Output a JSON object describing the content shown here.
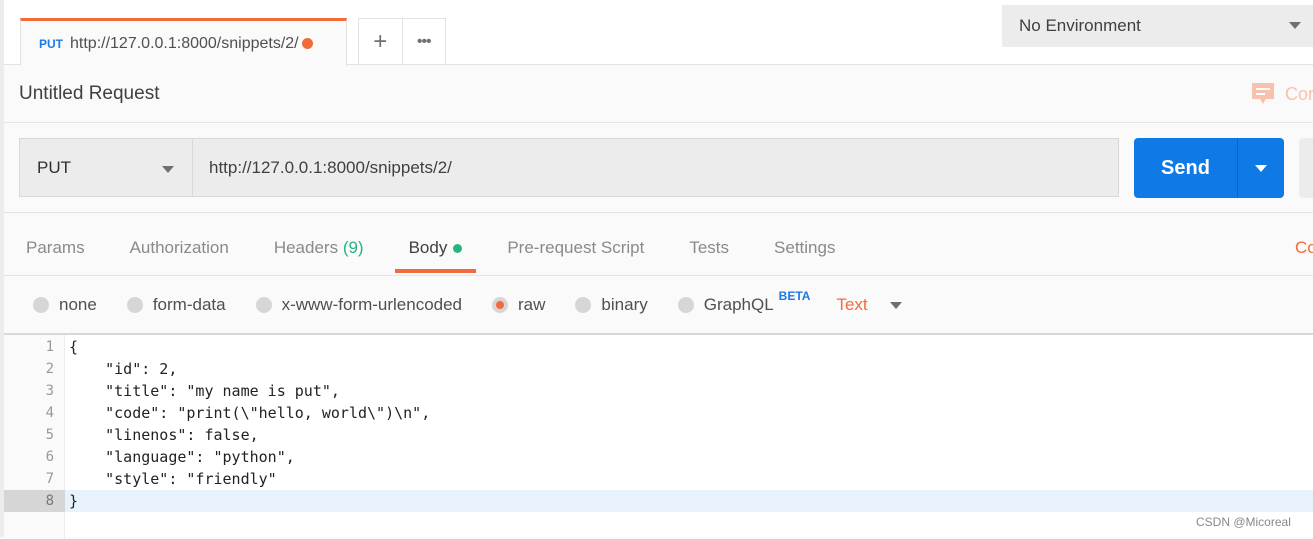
{
  "tabs": [
    {
      "method": "PUT",
      "url": "http://127.0.0.1:8000/snippets/2/",
      "unsaved": true
    }
  ],
  "tab_actions": {
    "new_tab": "+",
    "more": "•••"
  },
  "environment": {
    "selected": "No Environment"
  },
  "request": {
    "title": "Untitled Request",
    "comments_label": "Comments",
    "method": "PUT",
    "url": "http://127.0.0.1:8000/snippets/2/",
    "send_label": "Send"
  },
  "request_tabs": [
    {
      "label": "Params"
    },
    {
      "label": "Authorization"
    },
    {
      "label": "Headers",
      "count": "(9)"
    },
    {
      "label": "Body",
      "active": true
    },
    {
      "label": "Pre-request Script"
    },
    {
      "label": "Tests"
    },
    {
      "label": "Settings"
    }
  ],
  "cookies_label": "Cookies",
  "body_types": [
    {
      "label": "none"
    },
    {
      "label": "form-data"
    },
    {
      "label": "x-www-form-urlencoded"
    },
    {
      "label": "raw",
      "selected": true
    },
    {
      "label": "binary"
    },
    {
      "label": "GraphQL",
      "badge": "BETA"
    }
  ],
  "content_type": "Text",
  "editor": {
    "lines": [
      {
        "n": "1",
        "text": "{"
      },
      {
        "n": "2",
        "text": "    \"id\": 2,"
      },
      {
        "n": "3",
        "text": "    \"title\": \"my name is put\","
      },
      {
        "n": "4",
        "text": "    \"code\": \"print(\\\"hello, world\\\")\\n\","
      },
      {
        "n": "5",
        "text": "    \"linenos\": false,"
      },
      {
        "n": "6",
        "text": "    \"language\": \"python\","
      },
      {
        "n": "7",
        "text": "    \"style\": \"friendly\""
      },
      {
        "n": "8",
        "text": "}"
      }
    ],
    "active_line": 8
  },
  "watermark": "CSDN @Micoreal",
  "colors": {
    "accent": "#f26b3a",
    "primary": "#0f7ae5",
    "success": "#26b47f"
  }
}
